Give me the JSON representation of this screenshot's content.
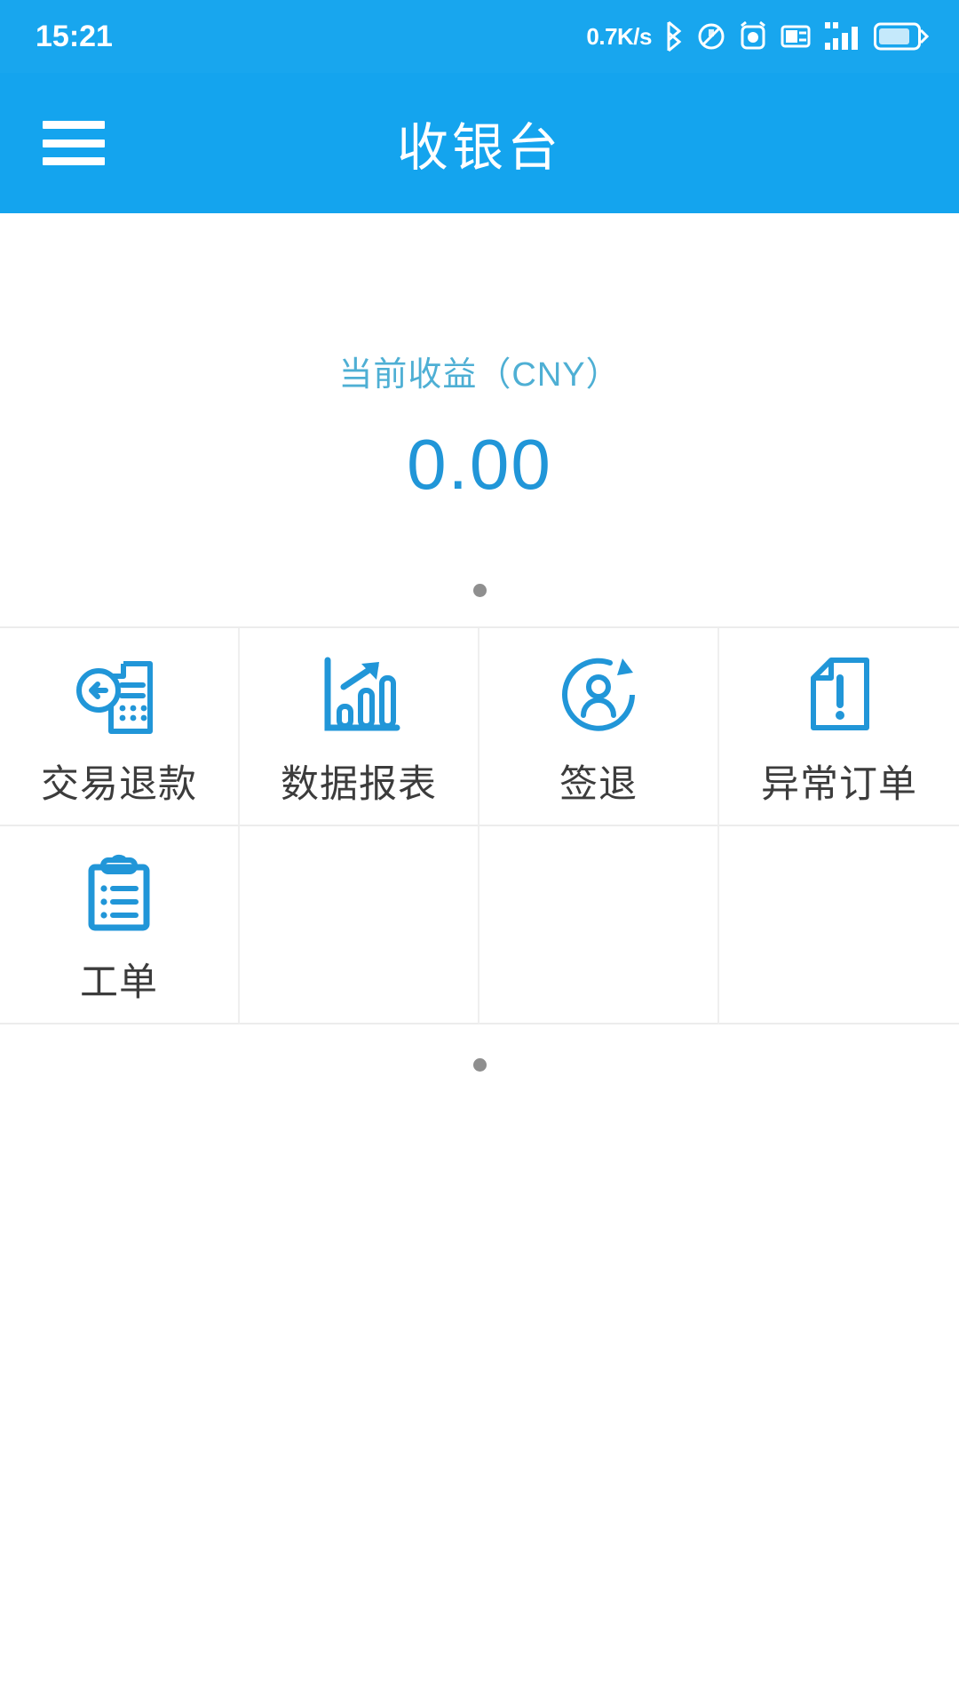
{
  "statusbar": {
    "time": "15:21",
    "network_speed": "0.7K/s",
    "icons": [
      "bluetooth-icon",
      "mute-icon",
      "alarm-icon",
      "sd-card-icon",
      "signal-icon",
      "battery-icon"
    ],
    "battery_level": "92"
  },
  "header": {
    "menu_icon": "hamburger-menu-icon",
    "title": "收银台"
  },
  "earnings": {
    "label": "当前收益（CNY）",
    "value": "0.00",
    "label_color": "#4EAFD4",
    "value_color": "#2196D8"
  },
  "carousel": {
    "top_dots": 1,
    "bottom_dots": 1,
    "dot_color": "#8f8f8f"
  },
  "grid": {
    "accent_color": "#2196D8",
    "items": [
      {
        "label": "交易退款",
        "icon": "transaction-refund-icon"
      },
      {
        "label": "数据报表",
        "icon": "data-report-chart-icon"
      },
      {
        "label": "签退",
        "icon": "sign-out-user-icon"
      },
      {
        "label": "异常订单",
        "icon": "abnormal-order-document-icon"
      },
      {
        "label": "工单",
        "icon": "work-order-clipboard-icon"
      },
      {
        "label": "",
        "icon": ""
      },
      {
        "label": "",
        "icon": ""
      },
      {
        "label": "",
        "icon": ""
      }
    ]
  },
  "theme": {
    "brand_blue": "#14A4EE",
    "statusbar_blue": "#18A6EE",
    "page_background": "#ffffff",
    "divider": "#ececec",
    "label_text": "#3c3c3c"
  }
}
